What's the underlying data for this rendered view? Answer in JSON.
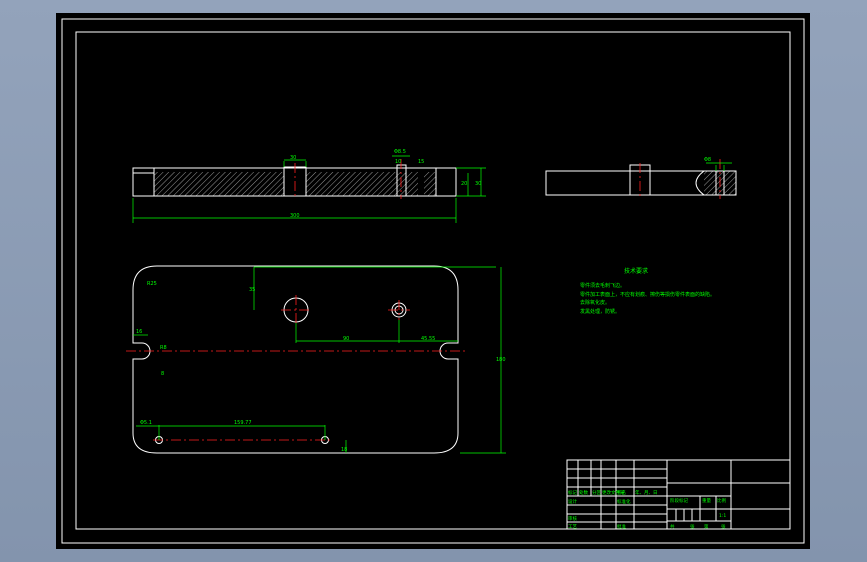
{
  "drawing": {
    "dimensions": {
      "top_view_length": "300",
      "top_slot_width": "30",
      "top_hole_callout": "Φ8.5",
      "top_hole_width": "10",
      "top_hole_depth": "15",
      "top_step_height": "20",
      "top_total_height": "30",
      "side_hole_callout": "Φ8",
      "corner_radius": "R25",
      "hole_offset_y": "35",
      "hole_spacing": "90",
      "right_offset": "45.55",
      "total_width": "180",
      "slot_width_label": "16",
      "slot_radius_label": "R8",
      "slot_depth_label": "8",
      "lower_hole_left": "Φ5.1",
      "lower_hole_spacing": "159.77",
      "lower_hole_offset": "18"
    },
    "notes": {
      "title": "技术要求",
      "lines": [
        "零件须去毛刺飞边。",
        "零件加工表面上，不应有划痕、擦伤等损伤零件表面的缺陷。",
        "去除氧化皮。",
        "发黑处理，防锈。"
      ]
    },
    "title_block": {
      "cells": [
        "标记",
        "处数",
        "分区",
        "更改文件号",
        "签名",
        "年、月、日",
        "设计",
        "标准化",
        "审核",
        "工艺",
        "批准",
        "阶段标记",
        "重量",
        "比例",
        "1:1",
        "共",
        "张",
        "第",
        "张"
      ]
    }
  }
}
